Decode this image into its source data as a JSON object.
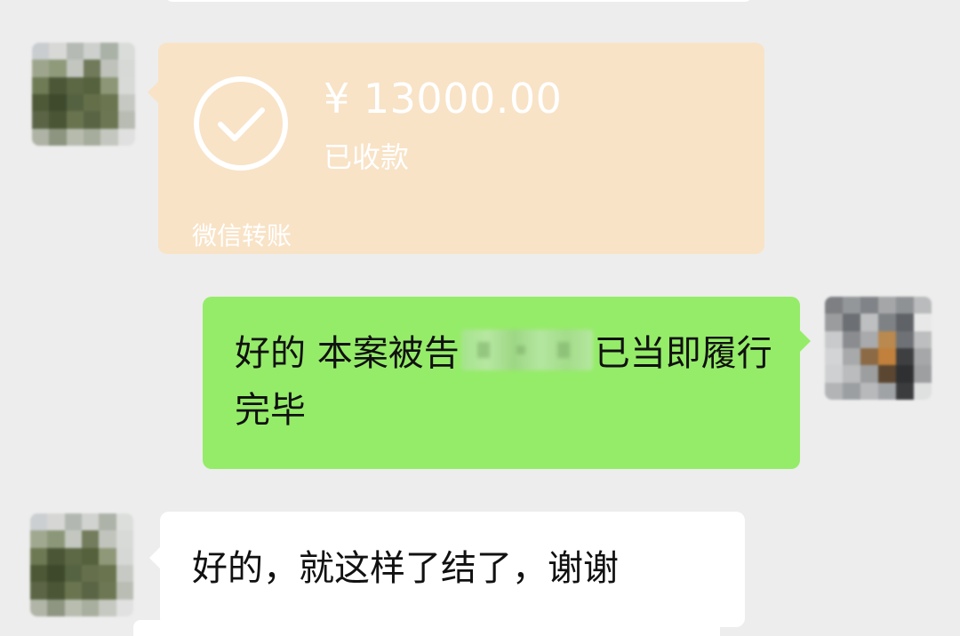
{
  "transfer": {
    "amount": "¥ 13000.00",
    "status": "已收款",
    "label": "微信转账"
  },
  "messages": {
    "outgoing": {
      "before_redaction": "好的 本案被告",
      "after_redaction": "已当即履行完毕"
    },
    "incoming": {
      "text": "好的，就这样了结了，谢谢"
    }
  },
  "colors": {
    "background": "#ededed",
    "transfer_card": "#f8e3c7",
    "outgoing_bubble": "#95ec69",
    "incoming_bubble": "#ffffff"
  },
  "icons": {
    "transfer_status": "check-circle-icon"
  }
}
